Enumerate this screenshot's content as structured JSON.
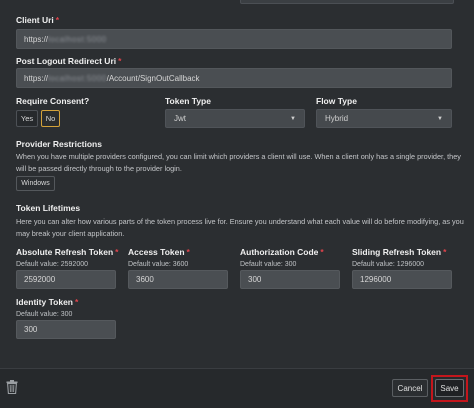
{
  "client_uri": {
    "label": "Client Uri",
    "required_mark": "*",
    "value_prefix": "https://",
    "value_masked": "localhost:5000"
  },
  "post_logout": {
    "label": "Post Logout Redirect Uri",
    "required_mark": "*",
    "value_prefix": "https://",
    "value_masked": "localhost:5000",
    "value_suffix": "/Account/SignOutCallback"
  },
  "require_consent": {
    "label": "Require Consent?",
    "options": [
      "Yes",
      "No"
    ],
    "selected": "No"
  },
  "token_type": {
    "label": "Token Type",
    "value": "Jwt"
  },
  "flow_type": {
    "label": "Flow Type",
    "value": "Hybrid"
  },
  "provider_restrictions": {
    "label": "Provider Restrictions",
    "description": "When you have multiple providers configured, you can limit which providers a client will use. When a client only has a single provider, they will be passed directly through to the provider login.",
    "button": "Windows"
  },
  "token_lifetimes": {
    "label": "Token Lifetimes",
    "description": "Here you can alter how various parts of the token process live for. Ensure you understand what each value will do before modifying, as you may break your client application.",
    "fields": [
      {
        "label": "Absolute Refresh Token",
        "required_mark": "*",
        "hint": "Default value: 2592000",
        "value": "2592000"
      },
      {
        "label": "Access Token",
        "required_mark": "*",
        "hint": "Default value: 3600",
        "value": "3600"
      },
      {
        "label": "Authorization Code",
        "required_mark": "*",
        "hint": "Default value: 300",
        "value": "300"
      },
      {
        "label": "Sliding Refresh Token",
        "required_mark": "*",
        "hint": "Default value: 1296000",
        "value": "1296000"
      },
      {
        "label": "Identity Token",
        "required_mark": "*",
        "hint": "Default value: 300",
        "value": "300"
      }
    ]
  },
  "footer": {
    "delete_icon": "trash-icon",
    "cancel_label": "Cancel",
    "save_label": "Save",
    "highlight_color": "#c4161c"
  }
}
